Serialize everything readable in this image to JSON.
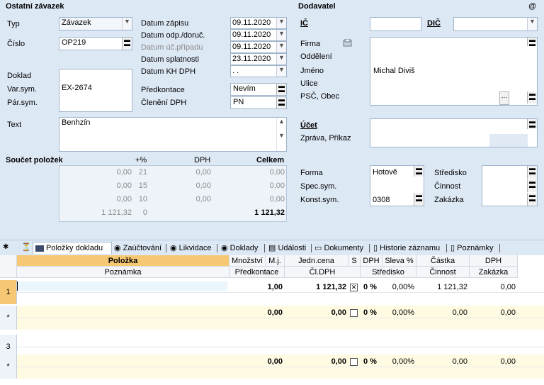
{
  "header": {
    "section_title": "Ostatní závazek",
    "supplier_title": "Dodavatel",
    "at_icon": "@"
  },
  "left": {
    "typ_label": "Typ",
    "typ_value": "Závazek",
    "cislo_label": "Číslo",
    "cislo_value": "OP219",
    "doklad_label": "Doklad",
    "varsym_label": "Var.sym.",
    "varsym_value": "EX-2674",
    "parsym_label": "Pár.sym.",
    "text_label": "Text",
    "text_value": "Benhzín"
  },
  "dates": {
    "zapisu_label": "Datum zápisu",
    "zapisu_value": "09.11.2020",
    "odp_label": "Datum odp./doruč.",
    "odp_value": "09.11.2020",
    "uc_label": "Datum úč.případu",
    "uc_value": "09.11.2020",
    "splatnosti_label": "Datum splatnosti",
    "splatnosti_value": "23.11.2020",
    "khdph_label": "Datum KH DPH",
    "khdph_value": ". .",
    "predkontace_label": "Předkontace",
    "predkontace_value": "Nevím",
    "cleneni_label": "Členění DPH",
    "cleneni_value": "PN"
  },
  "totals": {
    "title": "Součet položek",
    "col_pct": "+%",
    "col_dph": "DPH",
    "col_celkem": "Celkem",
    "rows": [
      {
        "base": "0,00",
        "pct": "21",
        "dph": "0,00",
        "total": "0,00"
      },
      {
        "base": "0,00",
        "pct": "15",
        "dph": "0,00",
        "total": "0,00"
      },
      {
        "base": "0,00",
        "pct": "10",
        "dph": "0,00",
        "total": "0,00"
      },
      {
        "base": "1 121,32",
        "pct": "0",
        "dph": "",
        "total": "1 121,32"
      }
    ]
  },
  "supplier": {
    "ic_label": "IČ",
    "dic_label": "DIČ",
    "firma_label": "Firma",
    "oddeleni_label": "Oddělení",
    "jmeno_label": "Jméno",
    "jmeno_value": "Michal Diviš",
    "ulice_label": "Ulice",
    "psc_label": "PSČ, Obec",
    "ucet_label": "Účet",
    "zprava_label": "Zpráva, Příkaz"
  },
  "payment": {
    "forma_label": "Forma",
    "forma_value": "Hotově",
    "spec_label": "Spec.sym.",
    "konst_label": "Konst.sym.",
    "konst_value": "0308",
    "stredisko_label": "Středisko",
    "cinnost_label": "Činnost",
    "zakazka_label": "Zakázka"
  },
  "tabs": [
    {
      "label": "Položky dokladu"
    },
    {
      "label": "Zaúčtování"
    },
    {
      "label": "Likvidace"
    },
    {
      "label": "Doklady"
    },
    {
      "label": "Události"
    },
    {
      "label": "Dokumenty"
    },
    {
      "label": "Historie záznamu"
    },
    {
      "label": "Poznámky"
    }
  ],
  "grid": {
    "h1": [
      "Položka",
      "Množství",
      "M.j.",
      "Jedn.cena",
      "S",
      "DPH",
      "Sleva %",
      "Částka",
      "DPH"
    ],
    "h2": [
      "Poznámka",
      "Předkontace",
      "Čl.DPH",
      "Středisko",
      "Činnost",
      "Zakázka"
    ],
    "rows": [
      {
        "num": "1",
        "qty": "1,00",
        "price": "1 121,32",
        "check": "✕",
        "dph": "0 %",
        "sleva": "0,00%",
        "castka": "1 121,32",
        "dphv": "0,00"
      },
      {
        "num": "*",
        "qty": "0,00",
        "price": "0,00",
        "check": "",
        "dph": "0 %",
        "sleva": "0,00%",
        "castka": "0,00",
        "dphv": "0,00"
      },
      {
        "num": "3",
        "qty": "",
        "price": "",
        "check": "",
        "dph": "",
        "sleva": "",
        "castka": "",
        "dphv": ""
      },
      {
        "num": "*",
        "qty": "0,00",
        "price": "0,00",
        "check": "",
        "dph": "0 %",
        "sleva": "0,00%",
        "castka": "0,00",
        "dphv": "0,00"
      }
    ]
  }
}
